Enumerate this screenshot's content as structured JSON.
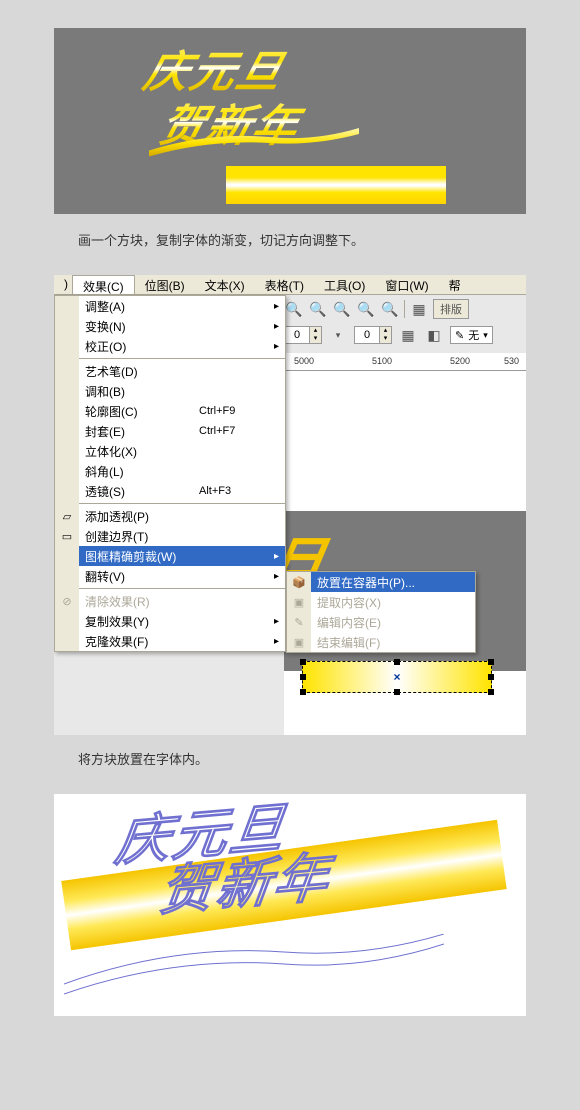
{
  "section1": {
    "text_line1": "庆元旦",
    "text_line2": "贺新年"
  },
  "caption1": "画一个方块，复制字体的渐变，切记方向调整下。",
  "menubar": {
    "effects": "效果(C)",
    "bitmap": "位图(B)",
    "text": "文本(X)",
    "table": "表格(T)",
    "tools": "工具(O)",
    "window": "窗口(W)",
    "help": "帮"
  },
  "toolbar2": {
    "spin1_value": "0",
    "spin2_value": "0",
    "fill_label": "无",
    "layout_btn": "排版"
  },
  "ruler": {
    "t1": "5000",
    "t2": "5100",
    "t3": "5200",
    "t4": "530"
  },
  "canvas_partial_text": "旦",
  "dropdown": {
    "adjust": "调整(A)",
    "transform": "变换(N)",
    "correction": "校正(O)",
    "artbrush": "艺术笔(D)",
    "blend": "调和(B)",
    "contour": "轮廓图(C)",
    "contour_sc": "Ctrl+F9",
    "envelope": "封套(E)",
    "envelope_sc": "Ctrl+F7",
    "extrude": "立体化(X)",
    "bevel": "斜角(L)",
    "lens": "透镜(S)",
    "lens_sc": "Alt+F3",
    "addperspective": "添加透视(P)",
    "createboundary": "创建边界(T)",
    "powerclip": "图框精确剪裁(W)",
    "flip": "翻转(V)",
    "cleareffect": "清除效果(R)",
    "copyeffect": "复制效果(Y)",
    "cloneeffect": "克隆效果(F)"
  },
  "submenu": {
    "place": "放置在容器中(P)...",
    "extract": "提取内容(X)",
    "edit": "编辑内容(E)",
    "finish": "结束编辑(F)"
  },
  "caption2": "将方块放置在字体内。",
  "section3": {
    "line1": "庆元旦",
    "line2": "贺新年"
  }
}
